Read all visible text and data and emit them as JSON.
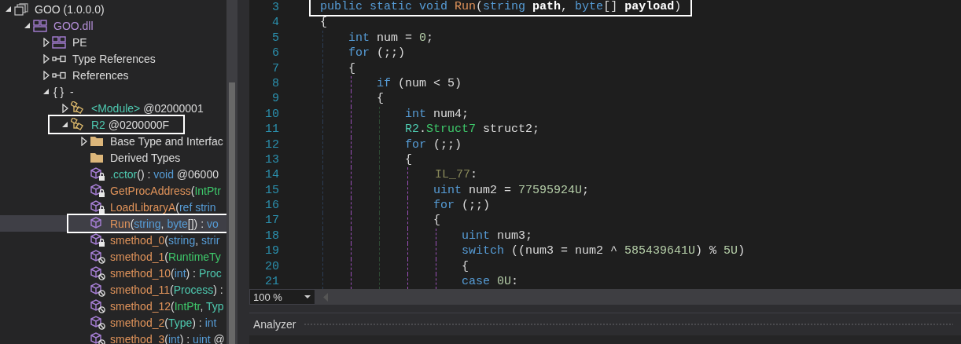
{
  "tree": [
    {
      "kind": "assembly",
      "expanded": true,
      "selected": false,
      "boxed": false,
      "label": [
        {
          "text": "GOO (1.0.0.0)",
          "kind": "plain"
        }
      ],
      "children": [
        {
          "kind": "module",
          "expanded": true,
          "selected": false,
          "boxed": false,
          "label": [
            {
              "text": "GOO.dll",
              "kind": "module"
            }
          ],
          "children": [
            {
              "kind": "module",
              "expanded": false,
              "selected": false,
              "boxed": false,
              "label": [
                {
                  "text": "PE",
                  "kind": "plain"
                }
              ]
            },
            {
              "kind": "reference",
              "expanded": false,
              "selected": false,
              "boxed": false,
              "label": [
                {
                  "text": "Type References",
                  "kind": "plain"
                }
              ]
            },
            {
              "kind": "reference",
              "expanded": false,
              "selected": false,
              "boxed": false,
              "label": [
                {
                  "text": "References",
                  "kind": "plain"
                }
              ]
            },
            {
              "kind": "namespace",
              "expanded": true,
              "selected": false,
              "boxed": false,
              "label": [
                {
                  "text": "{ }  -",
                  "kind": "plain"
                }
              ],
              "children": [
                {
                  "kind": "class",
                  "expanded": false,
                  "selected": false,
                  "boxed": false,
                  "label": [
                    {
                      "text": "<Module>",
                      "kind": "type"
                    },
                    {
                      "text": " @02000001",
                      "kind": "plain"
                    }
                  ]
                },
                {
                  "kind": "class",
                  "expanded": true,
                  "selected": false,
                  "boxed": true,
                  "label": [
                    {
                      "text": "R2",
                      "kind": "type"
                    },
                    {
                      "text": " @0200000F",
                      "kind": "plain"
                    }
                  ],
                  "children": [
                    {
                      "kind": "folder",
                      "expanded": false,
                      "selected": false,
                      "boxed": false,
                      "label": [
                        {
                          "text": "Base Type and Interfac",
                          "kind": "plain"
                        }
                      ]
                    },
                    {
                      "kind": "folder",
                      "selected": false,
                      "boxed": false,
                      "label": [
                        {
                          "text": "Derived Types",
                          "kind": "plain"
                        }
                      ]
                    },
                    {
                      "kind": "private",
                      "selected": false,
                      "boxed": false,
                      "label": [
                        {
                          "text": ".cctor",
                          "kind": "type"
                        },
                        {
                          "text": "() : ",
                          "kind": "plain"
                        },
                        {
                          "text": "void",
                          "kind": "keyword"
                        },
                        {
                          "text": " @06000",
                          "kind": "plain"
                        }
                      ]
                    },
                    {
                      "kind": "private",
                      "selected": false,
                      "boxed": false,
                      "label": [
                        {
                          "text": "GetProcAddress",
                          "kind": "method"
                        },
                        {
                          "text": "(",
                          "kind": "plain"
                        },
                        {
                          "text": "IntPtr",
                          "kind": "struct"
                        }
                      ]
                    },
                    {
                      "kind": "private",
                      "selected": false,
                      "boxed": false,
                      "label": [
                        {
                          "text": "LoadLibraryA",
                          "kind": "method"
                        },
                        {
                          "text": "(",
                          "kind": "plain"
                        },
                        {
                          "text": "ref strin",
                          "kind": "keyword"
                        }
                      ]
                    },
                    {
                      "kind": "method",
                      "selected": true,
                      "boxed": true,
                      "label": [
                        {
                          "text": "Run",
                          "kind": "method"
                        },
                        {
                          "text": "(",
                          "kind": "plain"
                        },
                        {
                          "text": "string",
                          "kind": "keyword"
                        },
                        {
                          "text": ", ",
                          "kind": "plain"
                        },
                        {
                          "text": "byte",
                          "kind": "keyword"
                        },
                        {
                          "text": "[]) : ",
                          "kind": "plain"
                        },
                        {
                          "text": "vo",
                          "kind": "keyword"
                        }
                      ]
                    },
                    {
                      "kind": "private",
                      "selected": false,
                      "boxed": false,
                      "label": [
                        {
                          "text": "smethod_0",
                          "kind": "method"
                        },
                        {
                          "text": "(",
                          "kind": "plain"
                        },
                        {
                          "text": "string",
                          "kind": "keyword"
                        },
                        {
                          "text": ", ",
                          "kind": "plain"
                        },
                        {
                          "text": "strir",
                          "kind": "keyword"
                        }
                      ]
                    },
                    {
                      "kind": "hidden",
                      "selected": false,
                      "boxed": false,
                      "label": [
                        {
                          "text": "smethod_1",
                          "kind": "method"
                        },
                        {
                          "text": "(",
                          "kind": "plain"
                        },
                        {
                          "text": "RuntimeTy",
                          "kind": "struct"
                        }
                      ]
                    },
                    {
                      "kind": "hidden",
                      "selected": false,
                      "boxed": false,
                      "label": [
                        {
                          "text": "smethod_10",
                          "kind": "method"
                        },
                        {
                          "text": "(",
                          "kind": "plain"
                        },
                        {
                          "text": "int",
                          "kind": "keyword"
                        },
                        {
                          "text": ") : ",
                          "kind": "plain"
                        },
                        {
                          "text": "Proc",
                          "kind": "type"
                        }
                      ]
                    },
                    {
                      "kind": "hidden",
                      "selected": false,
                      "boxed": false,
                      "label": [
                        {
                          "text": "smethod_11",
                          "kind": "method"
                        },
                        {
                          "text": "(",
                          "kind": "plain"
                        },
                        {
                          "text": "Process",
                          "kind": "type"
                        },
                        {
                          "text": ") :",
                          "kind": "plain"
                        }
                      ]
                    },
                    {
                      "kind": "hidden",
                      "selected": false,
                      "boxed": false,
                      "label": [
                        {
                          "text": "smethod_12",
                          "kind": "method"
                        },
                        {
                          "text": "(",
                          "kind": "plain"
                        },
                        {
                          "text": "IntPtr",
                          "kind": "struct"
                        },
                        {
                          "text": ", ",
                          "kind": "plain"
                        },
                        {
                          "text": "Typ",
                          "kind": "type"
                        }
                      ]
                    },
                    {
                      "kind": "hidden",
                      "selected": false,
                      "boxed": false,
                      "label": [
                        {
                          "text": "smethod_2",
                          "kind": "method"
                        },
                        {
                          "text": "(",
                          "kind": "plain"
                        },
                        {
                          "text": "Type",
                          "kind": "type"
                        },
                        {
                          "text": ") : ",
                          "kind": "plain"
                        },
                        {
                          "text": "int",
                          "kind": "keyword"
                        }
                      ]
                    },
                    {
                      "kind": "hidden",
                      "selected": false,
                      "boxed": false,
                      "label": [
                        {
                          "text": "smethod_3",
                          "kind": "method"
                        },
                        {
                          "text": "(",
                          "kind": "plain"
                        },
                        {
                          "text": "int",
                          "kind": "keyword"
                        },
                        {
                          "text": ") : ",
                          "kind": "plain"
                        },
                        {
                          "text": "uint",
                          "kind": "keyword"
                        },
                        {
                          "text": " @",
                          "kind": "plain"
                        }
                      ]
                    }
                  ]
                }
              ]
            }
          ]
        }
      ]
    }
  ],
  "code": [
    {
      "number": "3",
      "boxed": true,
      "tokens": [
        {
          "text": "public static void ",
          "kind": "keyword"
        },
        {
          "text": "Run",
          "kind": "method"
        },
        {
          "text": "(",
          "kind": "plain"
        },
        {
          "text": "string ",
          "kind": "keyword"
        },
        {
          "text": "path",
          "kind": "param"
        },
        {
          "text": ", ",
          "kind": "plain"
        },
        {
          "text": "byte",
          "kind": "keyword"
        },
        {
          "text": "[] ",
          "kind": "plain"
        },
        {
          "text": "payload",
          "kind": "param"
        },
        {
          "text": ")",
          "kind": "plain"
        }
      ]
    },
    {
      "number": "4",
      "boxed": false,
      "tokens": [
        {
          "text": "{",
          "kind": "plain"
        }
      ]
    },
    {
      "number": "5",
      "boxed": false,
      "tokens": [
        {
          "text": "    int ",
          "kind": "keyword"
        },
        {
          "text": "num = ",
          "kind": "plain"
        },
        {
          "text": "0",
          "kind": "number"
        },
        {
          "text": ";",
          "kind": "plain"
        }
      ]
    },
    {
      "number": "6",
      "boxed": false,
      "tokens": [
        {
          "text": "    for ",
          "kind": "keyword"
        },
        {
          "text": "(;;)",
          "kind": "plain"
        }
      ]
    },
    {
      "number": "7",
      "boxed": false,
      "tokens": [
        {
          "text": "    {",
          "kind": "plain"
        }
      ]
    },
    {
      "number": "8",
      "boxed": false,
      "tokens": [
        {
          "text": "        if ",
          "kind": "keyword"
        },
        {
          "text": "(num < 5)",
          "kind": "plain"
        }
      ]
    },
    {
      "number": "9",
      "boxed": false,
      "tokens": [
        {
          "text": "        {",
          "kind": "plain"
        }
      ]
    },
    {
      "number": "10",
      "boxed": false,
      "tokens": [
        {
          "text": "            int ",
          "kind": "keyword"
        },
        {
          "text": "num4;",
          "kind": "plain"
        }
      ]
    },
    {
      "number": "11",
      "boxed": false,
      "tokens": [
        {
          "text": "            R2",
          "kind": "type"
        },
        {
          "text": ".",
          "kind": "plain"
        },
        {
          "text": "Struct7",
          "kind": "struct"
        },
        {
          "text": " struct2;",
          "kind": "plain"
        }
      ]
    },
    {
      "number": "12",
      "boxed": false,
      "tokens": [
        {
          "text": "            for ",
          "kind": "keyword"
        },
        {
          "text": "(;;)",
          "kind": "plain"
        }
      ]
    },
    {
      "number": "13",
      "boxed": false,
      "tokens": [
        {
          "text": "            {",
          "kind": "plain"
        }
      ]
    },
    {
      "number": "14",
      "boxed": false,
      "tokens": [
        {
          "text": "                IL_77",
          "kind": "label"
        },
        {
          "text": ":",
          "kind": "plain"
        }
      ]
    },
    {
      "number": "15",
      "boxed": false,
      "tokens": [
        {
          "text": "                uint ",
          "kind": "keyword"
        },
        {
          "text": "num2 = ",
          "kind": "plain"
        },
        {
          "text": "77595924U",
          "kind": "number"
        },
        {
          "text": ";",
          "kind": "plain"
        }
      ]
    },
    {
      "number": "16",
      "boxed": false,
      "tokens": [
        {
          "text": "                for ",
          "kind": "keyword"
        },
        {
          "text": "(;;)",
          "kind": "plain"
        }
      ]
    },
    {
      "number": "17",
      "boxed": false,
      "tokens": [
        {
          "text": "                {",
          "kind": "plain"
        }
      ]
    },
    {
      "number": "18",
      "boxed": false,
      "tokens": [
        {
          "text": "                    uint ",
          "kind": "keyword"
        },
        {
          "text": "num3;",
          "kind": "plain"
        }
      ]
    },
    {
      "number": "19",
      "boxed": false,
      "tokens": [
        {
          "text": "                    switch ",
          "kind": "keyword"
        },
        {
          "text": "((num3 = num2 ^ ",
          "kind": "plain"
        },
        {
          "text": "585439641U",
          "kind": "number"
        },
        {
          "text": ") % ",
          "kind": "plain"
        },
        {
          "text": "5U",
          "kind": "number"
        },
        {
          "text": ")",
          "kind": "plain"
        }
      ]
    },
    {
      "number": "20",
      "boxed": false,
      "tokens": [
        {
          "text": "                    {",
          "kind": "plain"
        }
      ]
    },
    {
      "number": "21",
      "boxed": false,
      "tokens": [
        {
          "text": "                    case ",
          "kind": "keyword"
        },
        {
          "text": "0U",
          "kind": "number"
        },
        {
          "text": ":",
          "kind": "plain"
        }
      ]
    }
  ],
  "zoom": {
    "value": "100 %"
  },
  "analyzer": {
    "title": "Analyzer"
  }
}
